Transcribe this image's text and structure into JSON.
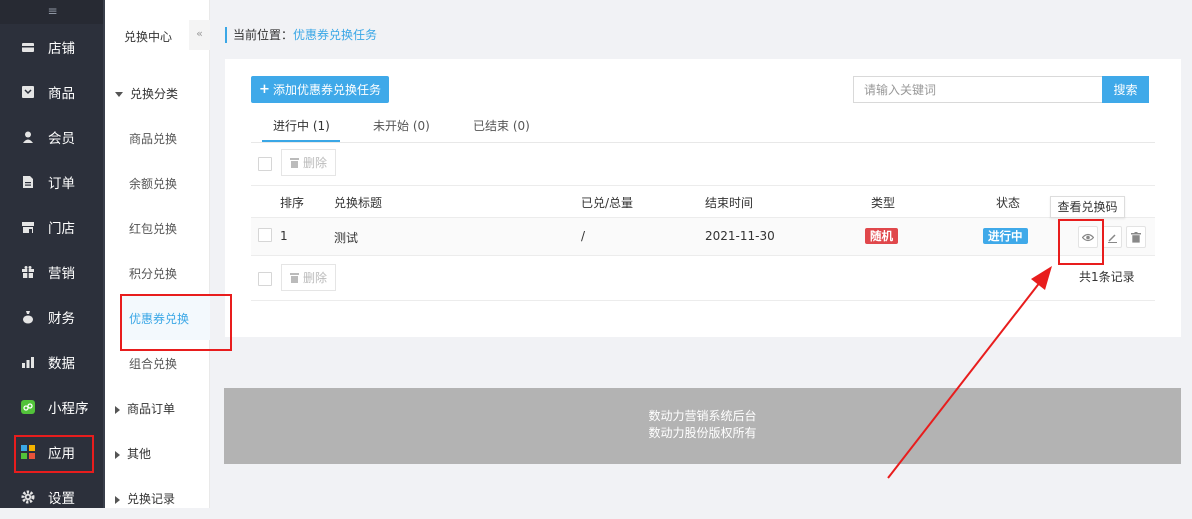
{
  "sidebar": {
    "collapse_icon": "≡",
    "items": [
      {
        "label": "店铺",
        "icon": "store-icon"
      },
      {
        "label": "商品",
        "icon": "goods-icon"
      },
      {
        "label": "会员",
        "icon": "member-icon"
      },
      {
        "label": "订单",
        "icon": "order-icon"
      },
      {
        "label": "门店",
        "icon": "shop-icon"
      },
      {
        "label": "营销",
        "icon": "gift-icon"
      },
      {
        "label": "财务",
        "icon": "money-bag-icon"
      },
      {
        "label": "数据",
        "icon": "chart-icon"
      },
      {
        "label": "小程序",
        "icon": "miniprogram-icon"
      },
      {
        "label": "应用",
        "icon": "apps-icon"
      },
      {
        "label": "设置",
        "icon": "gear-icon"
      }
    ]
  },
  "subnav": {
    "title": "兑换中心",
    "fold_icon": "«",
    "groups": [
      {
        "label": "兑换分类"
      },
      {
        "label": "商品订单"
      },
      {
        "label": "其他"
      },
      {
        "label": "兑换记录"
      }
    ],
    "items": [
      {
        "label": "商品兑换"
      },
      {
        "label": "余额兑换"
      },
      {
        "label": "红包兑换"
      },
      {
        "label": "积分兑换"
      },
      {
        "label": "优惠券兑换"
      },
      {
        "label": "组合兑换"
      }
    ]
  },
  "breadcrumb": {
    "prefix": "当前位置：",
    "current": "优惠券兑换任务"
  },
  "toolbar": {
    "add_label": "添加优惠券兑换任务",
    "search_placeholder": "请输入关键词",
    "search_label": "搜索"
  },
  "tabs": [
    {
      "label": "进行中 (1)"
    },
    {
      "label": "未开始 (0)"
    },
    {
      "label": "已结束 (0)"
    }
  ],
  "delete_label": "删除",
  "table": {
    "headers": [
      "排序",
      "兑换标题",
      "已兑/总量",
      "结束时间",
      "类型",
      "状态"
    ],
    "rows": [
      {
        "sort": "1",
        "title": "测试",
        "redeemed": "/",
        "end_time": "2021-11-30",
        "type": "随机",
        "status": "进行中"
      }
    ]
  },
  "tooltip": "查看兑换码",
  "total": "共1条记录",
  "footer": {
    "line1": "数动力营销系统后台",
    "line2": "数动力股份版权所有"
  },
  "colors": {
    "accent": "#3fa9e9",
    "sidebar_bg": "#2c303b",
    "type_tag": "#e0474b",
    "status_tag": "#3fa9e9",
    "highlight": "#e81d1d"
  }
}
